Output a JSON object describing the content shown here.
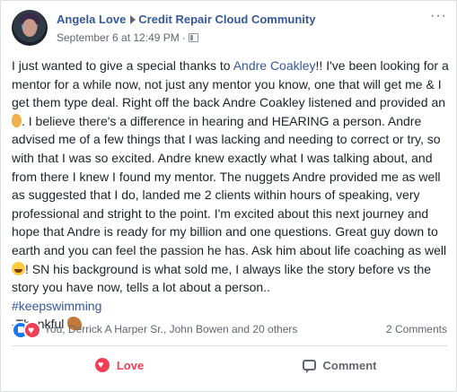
{
  "post": {
    "author": "Angela Love",
    "group": "Credit Repair Cloud Community",
    "timestamp": "September 6 at 12:49 PM",
    "separator": "·",
    "more_label": "···",
    "body": {
      "seg1": "I just wanted to give a special thanks to ",
      "mention": "Andre Coakley",
      "seg2": "!! I've been looking for a mentor for a while now, not just any mentor you know, one that will get me & I get them type deal. Right off the back Andre Coakley listened and provided an ",
      "seg3": ". I believe there's a difference in hearing and HEARING a person. Andre advised me of a few things that I was lacking and needing to correct or try, so with that I was so excited. Andre knew exactly what I was talking about, and from there I knew I found my mentor. The nuggets Andre provided me as well as suggested that I do, landed me 2 clients within hours of speaking, very professional and stright to the point. I'm excited about this next journey and hope that Andre is ready for my billion and one questions. Great guy down to earth and you can feel the passion he has. Ask him about life coaching as well ",
      "seg4": "! SN his background is what sold me, I always like the story before vs the story you have now, tells a lot about a person..",
      "hashtag": "#keepswimming",
      "closing": "-Thankful "
    }
  },
  "reactions": {
    "names": "You, Derrick A Harper Sr., John Bowen and 20 others",
    "comments": "2 Comments"
  },
  "actions": {
    "love_label": "Love",
    "comment_label": "Comment"
  },
  "colors": {
    "link": "#365899",
    "love": "#f33e58",
    "like": "#1877f2"
  }
}
